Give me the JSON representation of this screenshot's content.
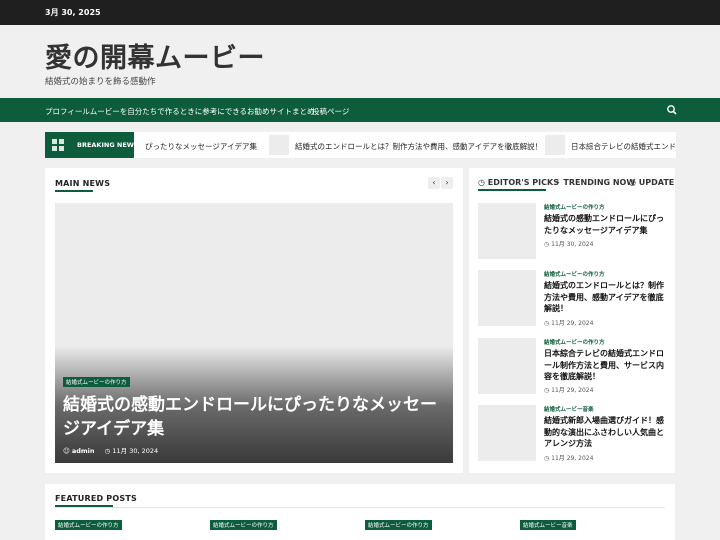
{
  "topbar": {
    "date": "3月 30, 2025"
  },
  "site": {
    "title": "愛の開幕ムービー",
    "tagline": "結婚式の始まりを飾る感動作"
  },
  "nav": {
    "items": [
      "プロフィールムービーを自分たちで作るときに参考にできるお勧めサイトまとめ",
      "投稿ページ"
    ],
    "search_icon": "search-icon"
  },
  "breaking": {
    "label": "BREAKING NEWS",
    "items": [
      "ぴったりなメッセージアイデア集",
      "結婚式のエンドロールとは？制作方法や費用、感動アイデアを徹底解説！",
      "日本綜合テレビの結婚式エンドロ"
    ]
  },
  "main_news": {
    "title": "MAIN NEWS",
    "prev": "‹",
    "next": "›",
    "hero": {
      "category": "結婚式ムービーの作り方",
      "title": "結婚式の感動エンドロールにぴったりなメッセージアイデア集",
      "author": "admin",
      "date": "11月 30, 2024"
    }
  },
  "sidebar": {
    "tabs": [
      "EDITOR'S PICKS",
      "TRENDING NOW",
      "UPDATE"
    ],
    "items": [
      {
        "category": "結婚式ムービーの作り方",
        "title": "結婚式の感動エンドロールにぴったりなメッセージアイデア集",
        "date": "11月 30, 2024"
      },
      {
        "category": "結婚式ムービーの作り方",
        "title": "結婚式のエンドロールとは？制作方法や費用、感動アイデアを徹底解説！",
        "date": "11月 29, 2024"
      },
      {
        "category": "結婚式ムービーの作り方",
        "title": "日本綜合テレビの結婚式エンドロール制作方法と費用、サービス内容を徹底解説！",
        "date": "11月 29, 2024"
      },
      {
        "category": "結婚式ムービー音楽",
        "title": "結婚式新郎入場曲選びガイド！感動的な演出にふさわしい人気曲とアレンジ方法",
        "date": "11月 29, 2024"
      }
    ]
  },
  "featured": {
    "title": "FEATURED POSTS",
    "categories": [
      "結婚式ムービーの作り方",
      "結婚式ムービーの作り方",
      "結婚式ムービーの作り方",
      "結婚式ムービー音楽"
    ]
  },
  "colors": {
    "accent": "#0d5c3b",
    "topbar": "#1f1f1f"
  }
}
